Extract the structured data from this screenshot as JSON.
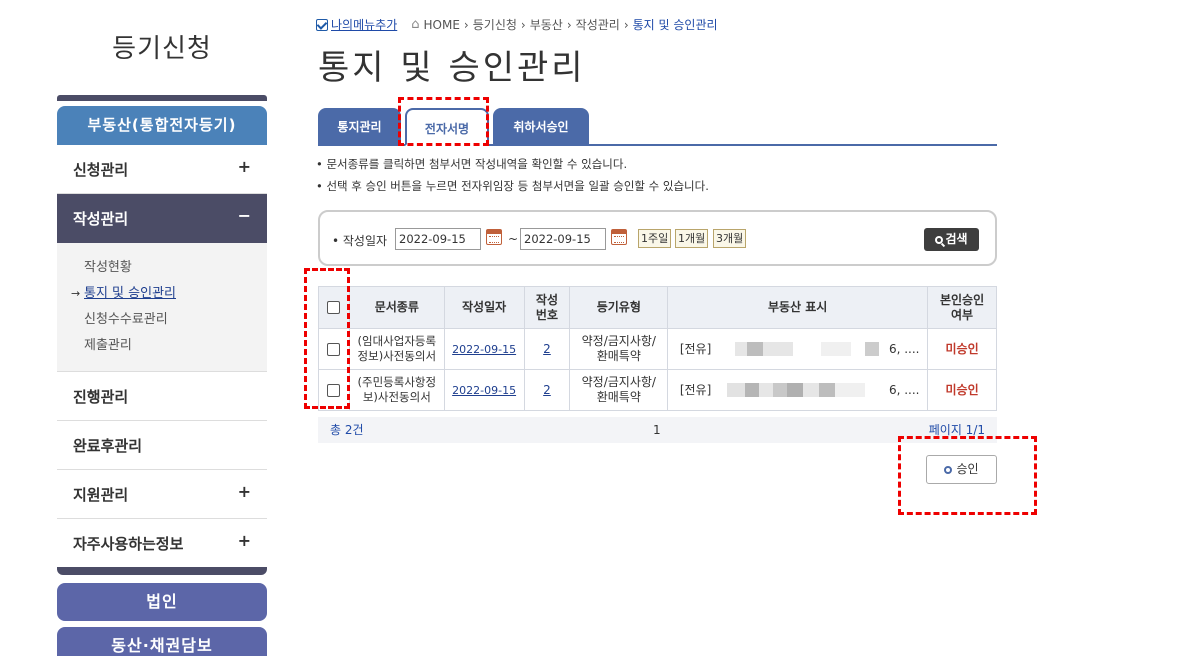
{
  "sidebar": {
    "title": "등기신청",
    "category": "부동산(통합전자등기)",
    "items": [
      {
        "label": "신청관리",
        "toggle": "+"
      },
      {
        "label": "작성관리",
        "toggle": "−"
      },
      {
        "label": "진행관리",
        "toggle": ""
      },
      {
        "label": "완료후관리",
        "toggle": ""
      },
      {
        "label": "지원관리",
        "toggle": "+"
      },
      {
        "label": "자주사용하는정보",
        "toggle": "+"
      }
    ],
    "submenu": [
      "작성현황",
      "통지 및 승인관리",
      "신청수수료관리",
      "제출관리"
    ],
    "submenu_arrow": "→",
    "big_buttons": [
      "법인",
      "동산·채권담보"
    ]
  },
  "breadcrumb": {
    "mymenu": "나의메뉴추가",
    "home": "HOME",
    "path": [
      "등기신청",
      "부동산",
      "작성관리",
      "통지 및 승인관리"
    ],
    "separator": "›"
  },
  "page_title": "통지 및 승인관리",
  "tabs": [
    "통지관리",
    "전자서명",
    "취하서승인"
  ],
  "notes": [
    "• 문서종류를 클릭하면 첨부서면 작성내역을 확인할 수 있습니다.",
    "• 선택 후 승인 버튼을 누르면 전자위임장 등 첨부서면을 일괄 승인할 수 있습니다."
  ],
  "search": {
    "label": "• 작성일자",
    "from": "2022-09-15",
    "tilde": "~",
    "to": "2022-09-15",
    "quick": [
      "1주일",
      "1개월",
      "3개월"
    ],
    "button": "검색"
  },
  "table": {
    "headers": [
      "문서종류",
      "작성일자",
      "작성\n번호",
      "등기유형",
      "부동산 표시",
      "본인승인\n여부"
    ],
    "rows": [
      {
        "doc": "(임대사업자등록\n정보)사전동의서",
        "date": "2022-09-15",
        "no": "2",
        "type": "약정/금지사항/\n환매특약",
        "prop_prefix": "[전유]",
        "prop_suffix": "6, ....",
        "status": "미승인"
      },
      {
        "doc": "(주민등록사항정\n보)사전동의서",
        "date": "2022-09-15",
        "no": "2",
        "type": "약정/금지사항/\n환매특약",
        "prop_prefix": "[전유]",
        "prop_suffix": "6, ....",
        "status": "미승인"
      }
    ]
  },
  "footer": {
    "total": "총 2건",
    "page_num": "1",
    "pages": "페이지 1/1"
  },
  "approve_button": "승인",
  "colors": {
    "accent": "#4b6aa8",
    "sidebar_dark": "#4b4c66",
    "status": "#c0392b",
    "highlight": "#e00000"
  }
}
